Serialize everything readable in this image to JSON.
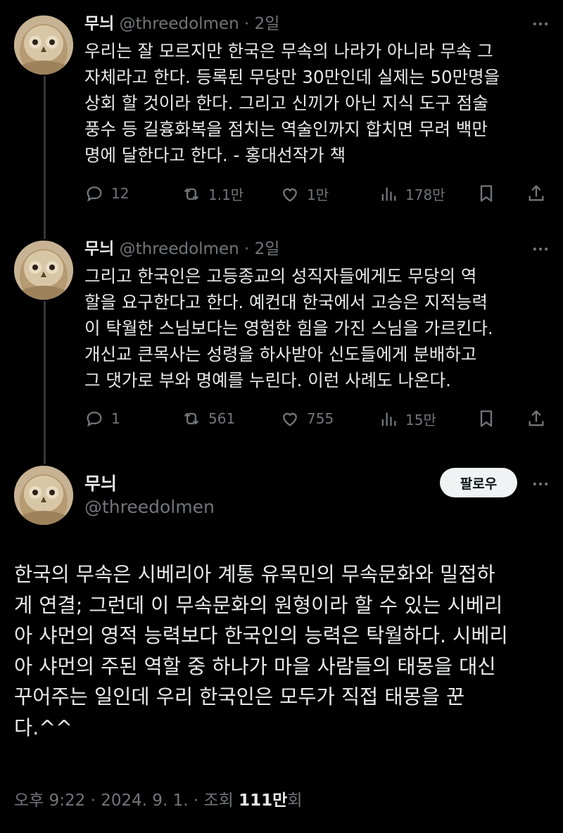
{
  "tweets": [
    {
      "name": "무늬",
      "handle": "@threedolmen",
      "sep": "·",
      "time": "2일",
      "text": "우리는 잘 모르지만 한국은 무속의 나라가 아니라 무속 그\n자체라고 한다. 등록된 무당만 30만인데 실제는 50만명을\n상회 할 것이라 한다. 그리고 신끼가 아닌 지식 도구 점술\n풍수 등 길흉화복을 점치는 역술인까지 합치면 무려 백만\n명에 달한다고 한다. - 홍대선작가 책",
      "replies": "12",
      "reposts": "1.1만",
      "likes": "1만",
      "views": "178만"
    },
    {
      "name": "무늬",
      "handle": "@threedolmen",
      "sep": "·",
      "time": "2일",
      "text": "그리고 한국인은 고등종교의 성직자들에게도 무당의 역\n할을 요구한다고 한다. 예컨대 한국에서 고승은 지적능력\n이 탁월한 스님보다는 영험한 힘을 가진 스님을 가르킨다.\n개신교 큰목사는 성령을 하사받아 신도들에게 분배하고\n그 댓가로 부와 명예를 누린다. 이런 사례도 나온다.",
      "replies": "1",
      "reposts": "561",
      "likes": "755",
      "views": "15만"
    }
  ],
  "main": {
    "name": "무늬",
    "handle": "@threedolmen",
    "follow_label": "팔로우",
    "text": "한국의 무속은 시베리아 계통 유목민의 무속문화와 밀접하\n게 연결; 그런데 이 무속문화의 원형이라 할 수 있는 시베리\n아 샤먼의 영적 능력보다 한국인의 능력은 탁월하다. 시베리\n아 샤먼의 주된 역할 중 하나가 마을 사람들의 태몽을 대신\n꾸어주는 일인데 우리 한국인은 모두가 직접 태몽을 꾼\n다.^^",
    "time": "오후 9:22",
    "date": "2024. 9. 1.",
    "views_prefix": "조회",
    "views": "111만",
    "views_suffix": "회",
    "sep": "·"
  },
  "icons": {
    "reply": "reply-icon",
    "repost": "repost-icon",
    "like": "heart-icon",
    "views": "analytics-icon",
    "bookmark": "bookmark-icon",
    "share": "share-icon",
    "more": "more-icon"
  },
  "colors": {
    "background": "#000000",
    "text": "#e7e9ea",
    "muted": "#71767b",
    "thread_line": "#333639",
    "follow_button": "#eff3f4"
  }
}
